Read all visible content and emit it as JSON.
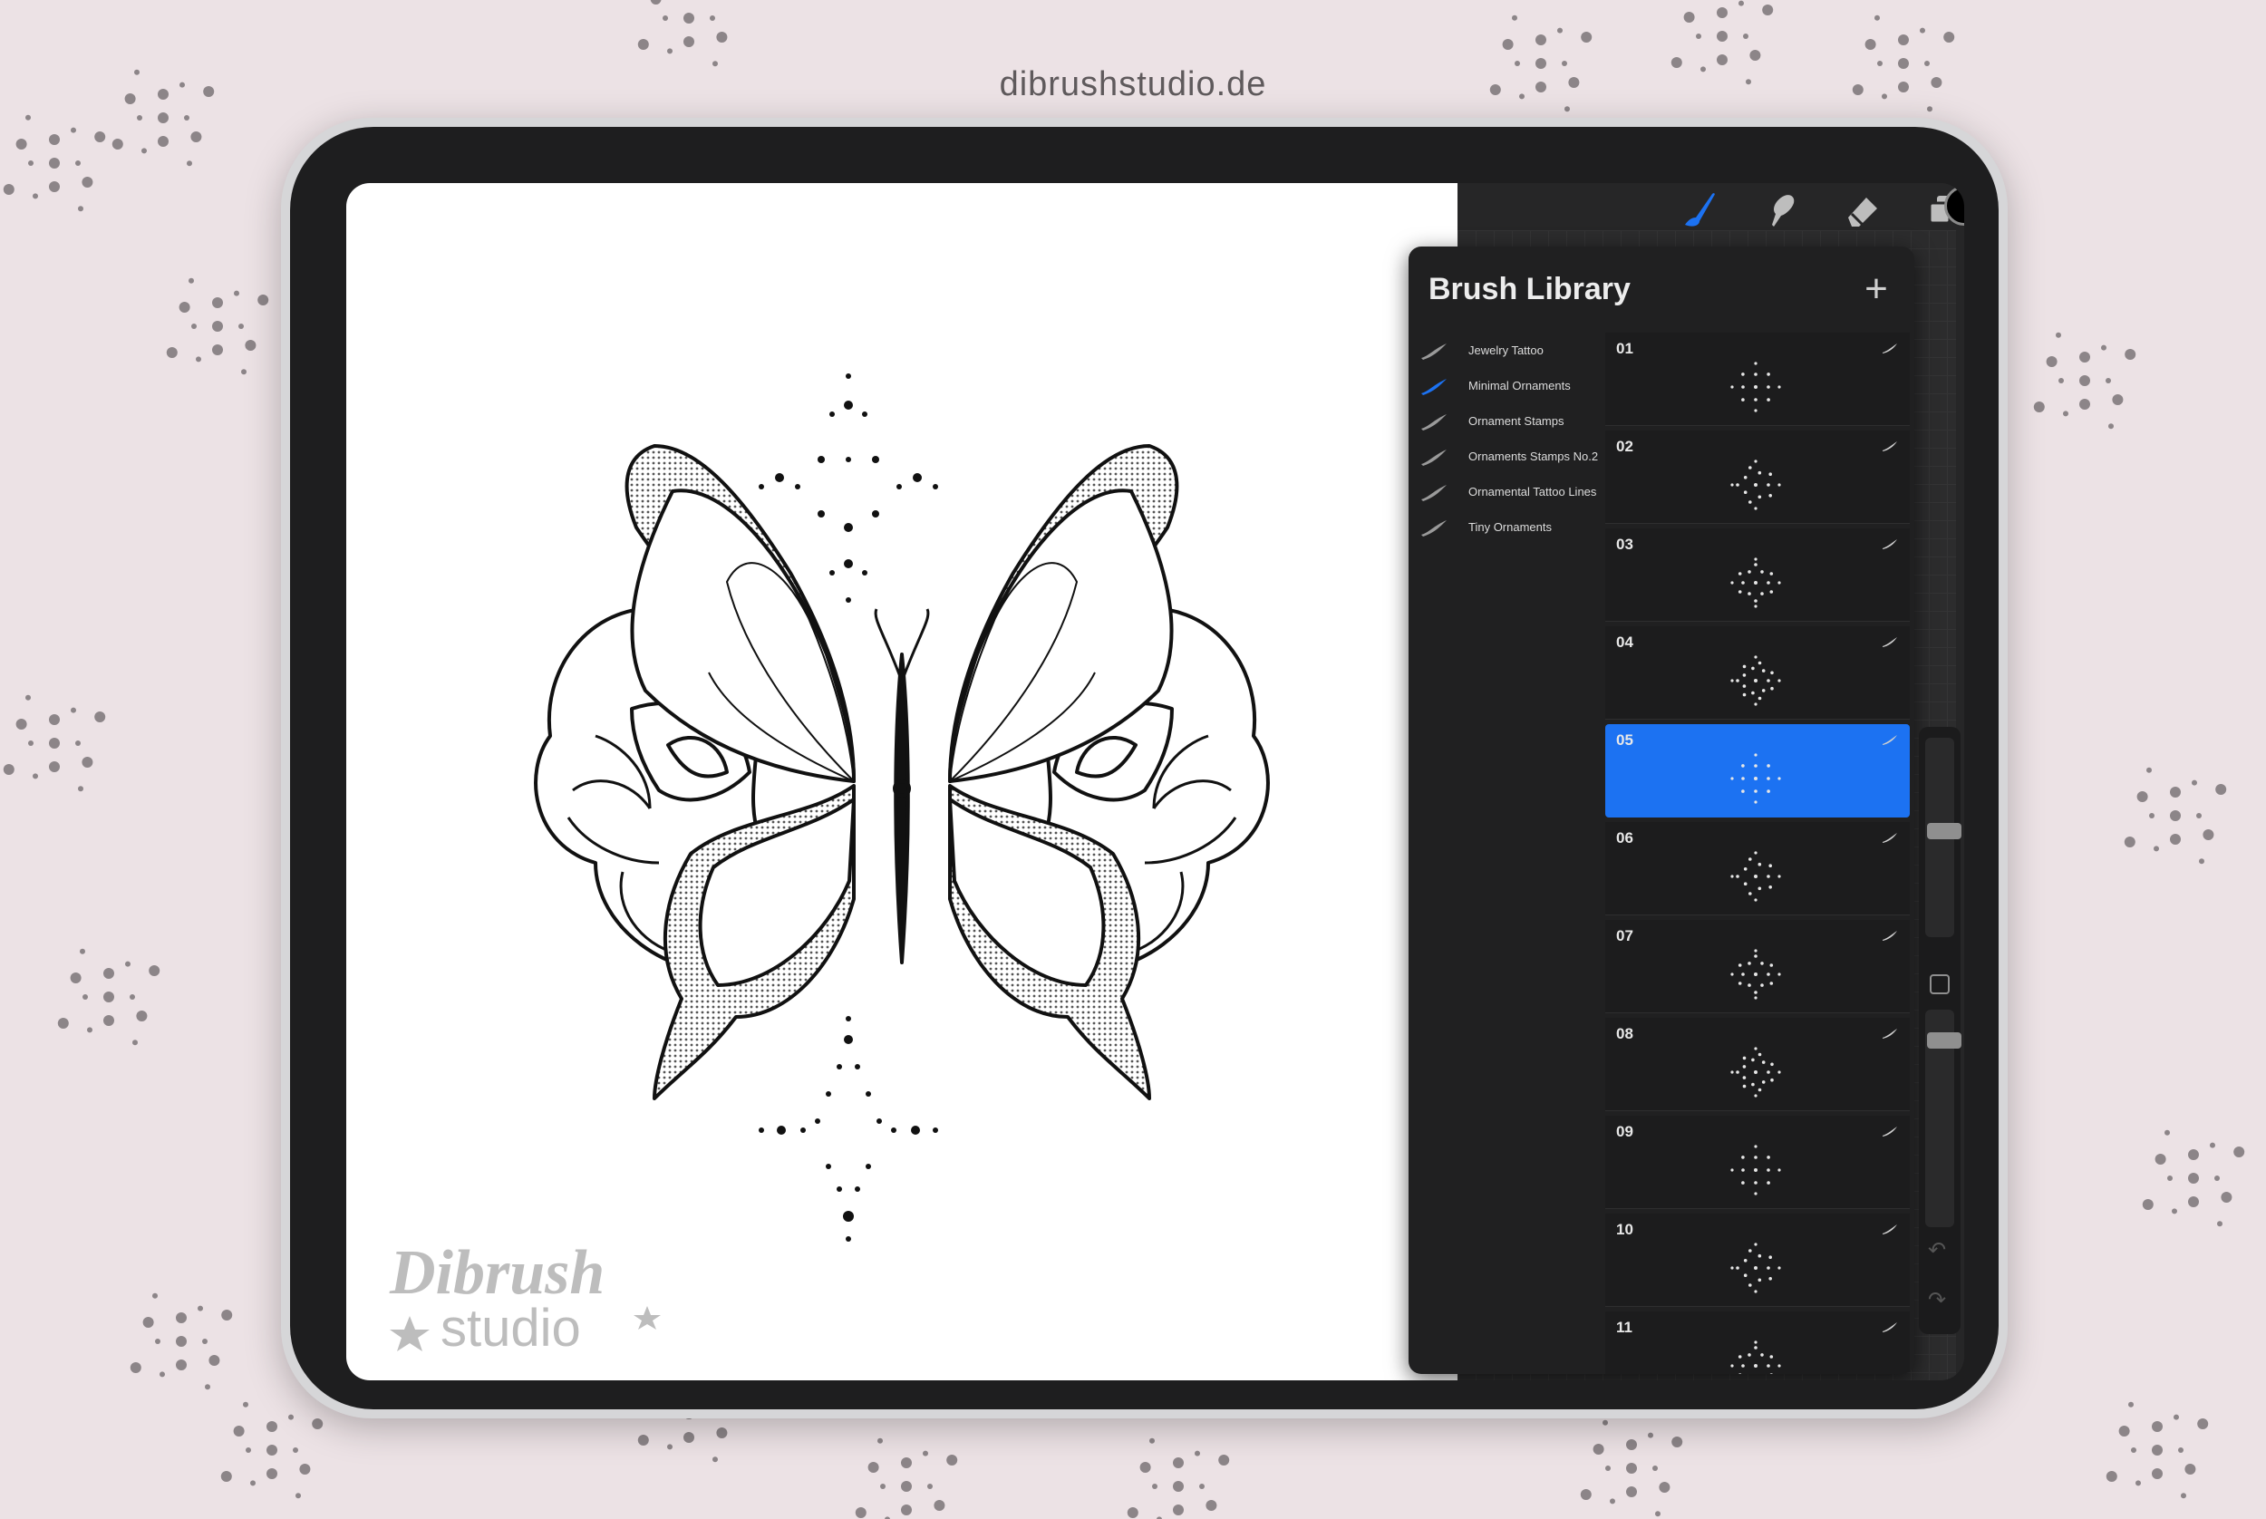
{
  "website": "dibrushstudio.de",
  "toolbar": {
    "tools": [
      "brush-icon",
      "smudge-icon",
      "eraser-icon",
      "layers-icon"
    ],
    "active_tool": "brush-icon",
    "active_color": "#000000"
  },
  "brush_library": {
    "title": "Brush Library",
    "add_icon": "plus-icon",
    "sets": [
      {
        "label": "Jewelry Tattoo",
        "active": false
      },
      {
        "label": "Minimal Ornaments",
        "active": true
      },
      {
        "label": "Ornament Stamps",
        "active": false
      },
      {
        "label": "Ornaments Stamps No.2",
        "active": false
      },
      {
        "label": "Ornamental Tattoo Lines",
        "active": false
      },
      {
        "label": "Tiny Ornaments",
        "active": false
      }
    ],
    "brushes": [
      "01",
      "02",
      "03",
      "04",
      "05",
      "06",
      "07",
      "08",
      "09",
      "10",
      "11"
    ],
    "selected_brush": "05"
  },
  "watermark": {
    "line1": "Dibrush",
    "line2": "studio"
  },
  "colors": {
    "accent": "#1c72f2",
    "panel": "#202021",
    "canvas": "#ffffff",
    "background": "#ece2e5"
  }
}
